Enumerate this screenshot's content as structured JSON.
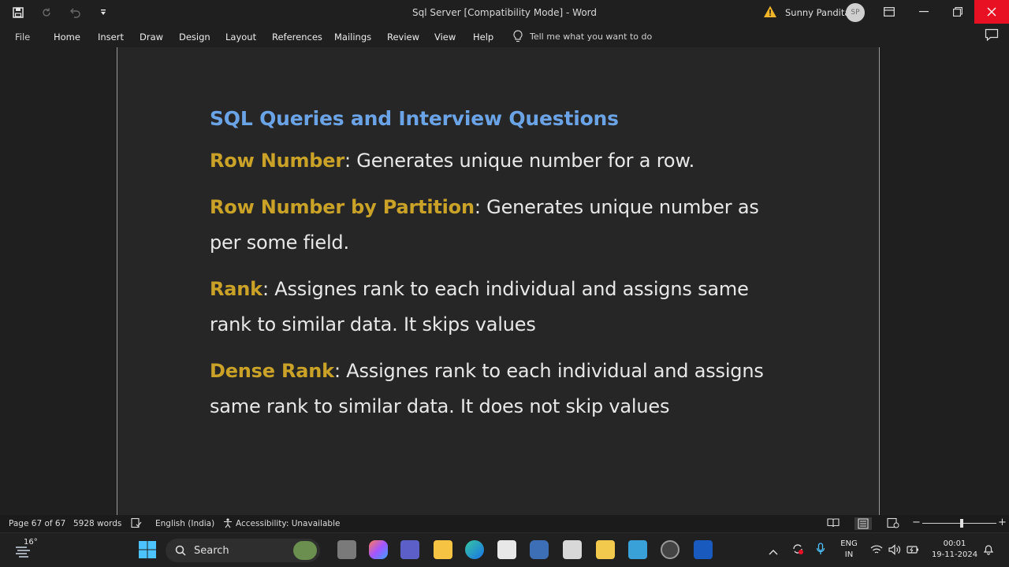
{
  "window": {
    "title": "Sql Server [Compatibility Mode]  -  Word",
    "user_name": "Sunny Pandita",
    "user_initials": "SP",
    "close_color": "#e81123"
  },
  "ribbon": {
    "tabs": [
      "File",
      "Home",
      "Insert",
      "Draw",
      "Design",
      "Layout",
      "References",
      "Mailings",
      "Review",
      "View",
      "Help"
    ],
    "tell_me": "Tell me what you want to do"
  },
  "document": {
    "heading": "SQL Queries and Interview Questions",
    "heading_color": "#6aa3e6",
    "term_color": "#c9a227",
    "items": [
      {
        "term": "Row Number",
        "text": ": Generates unique number for a row."
      },
      {
        "term": "Row Number by Partition",
        "text": ": Generates unique number as per some field."
      },
      {
        "term": "Rank",
        "text": ": Assignes rank to each individual and assigns same rank to similar data. It skips values"
      },
      {
        "term": "Dense Rank",
        "text": ": Assignes rank to each individual and assigns same rank to similar data. It does not skip values"
      }
    ]
  },
  "statusbar": {
    "page": "Page 67 of 67",
    "words": "5928 words",
    "language": "English (India)",
    "accessibility": "Accessibility: Unavailable"
  },
  "taskbar": {
    "weather_temp": "16°",
    "search_label": "Search",
    "lang_top": "ENG",
    "lang_bottom": "IN",
    "time": "00:01",
    "date": "19-11-2024"
  }
}
